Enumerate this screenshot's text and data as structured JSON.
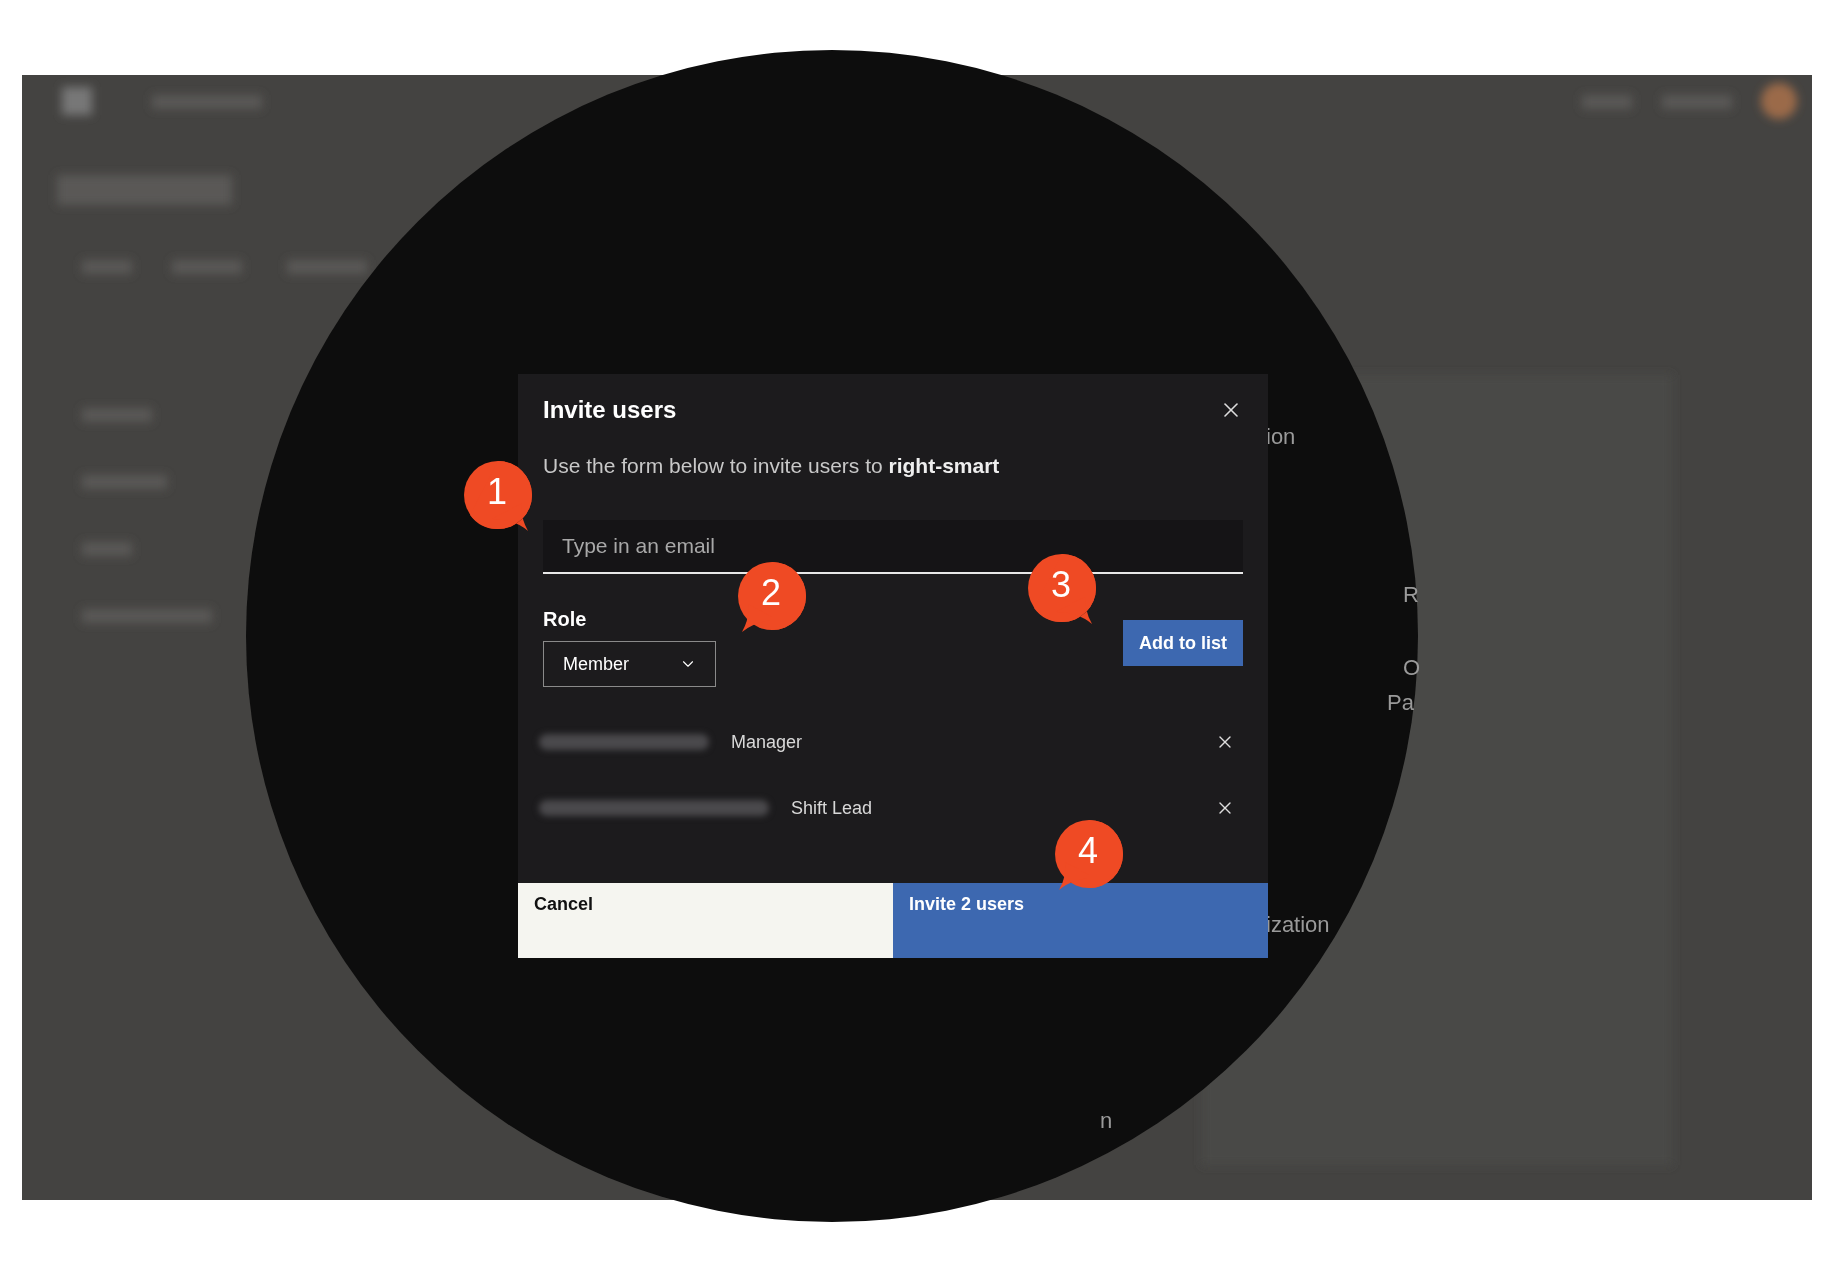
{
  "dialog": {
    "title": "Invite users",
    "subtitle": "Use the form below to invite users to **right-smart**",
    "email_field": {
      "placeholder": "Type in an email"
    },
    "role_label": "Role",
    "role_select": {
      "value": "Member"
    },
    "add_button": "Add to list",
    "invitees": [
      {
        "role": "Manager"
      },
      {
        "role": "Shift Lead"
      }
    ],
    "cancel_button": "Cancel",
    "invite_button": "Invite 2 users"
  },
  "callouts": [
    {
      "number": "1"
    },
    {
      "number": "2"
    },
    {
      "number": "3"
    },
    {
      "number": "4"
    }
  ],
  "background_fragments": [
    "ion",
    "R",
    "O",
    "Pa",
    "ization",
    "n"
  ]
}
